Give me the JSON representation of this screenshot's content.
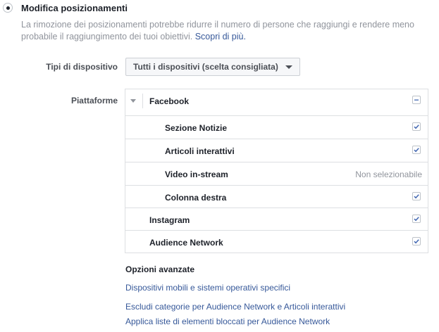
{
  "section": {
    "title": "Modifica posizionamenti",
    "description": "La rimozione dei posizionamenti potrebbe ridurre il numero di persone che raggiungi e rendere meno probabile il raggiungimento dei tuoi obiettivi.",
    "learn_more": "Scopri di più."
  },
  "device": {
    "label": "Tipi di dispositivo",
    "selected": "Tutti i dispositivi (scelta consigliata)"
  },
  "platforms": {
    "label": "Piattaforme",
    "facebook": {
      "name": "Facebook",
      "state": "indeterminate",
      "items": [
        {
          "name": "Sezione Notizie",
          "checked": true
        },
        {
          "name": "Articoli interattivi",
          "checked": true
        },
        {
          "name": "Video in-stream",
          "status": "Non selezionabile"
        },
        {
          "name": "Colonna destra",
          "checked": true
        }
      ]
    },
    "others": [
      {
        "name": "Instagram",
        "checked": true
      },
      {
        "name": "Audience Network",
        "checked": true
      }
    ]
  },
  "advanced": {
    "title": "Opzioni avanzate",
    "links": [
      "Dispositivi mobili e sistemi operativi specifici",
      "Escludi categorie per Audience Network e Articoli interattivi",
      "Applica liste di elementi bloccati per Audience Network"
    ]
  },
  "colors": {
    "link": "#365899",
    "checkmark": "#4267b2",
    "muted": "#90949c",
    "border": "#dddfe2"
  }
}
